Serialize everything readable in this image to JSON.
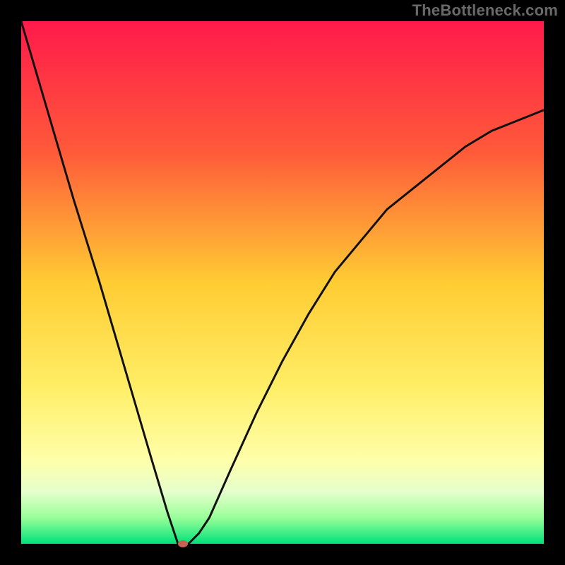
{
  "watermark": "TheBottleneck.com",
  "chart_data": {
    "type": "line",
    "title": "",
    "xlabel": "",
    "ylabel": "",
    "xlim": [
      0,
      1
    ],
    "ylim": [
      0,
      1
    ],
    "series": [
      {
        "name": "curve",
        "x": [
          0.0,
          0.05,
          0.1,
          0.15,
          0.2,
          0.25,
          0.28,
          0.3,
          0.32,
          0.34,
          0.36,
          0.4,
          0.45,
          0.5,
          0.55,
          0.6,
          0.65,
          0.7,
          0.75,
          0.8,
          0.85,
          0.9,
          0.95,
          1.0
        ],
        "y": [
          1.0,
          0.83,
          0.66,
          0.5,
          0.33,
          0.16,
          0.06,
          0.0,
          0.0,
          0.02,
          0.05,
          0.14,
          0.25,
          0.35,
          0.44,
          0.52,
          0.58,
          0.64,
          0.68,
          0.72,
          0.76,
          0.79,
          0.81,
          0.83
        ]
      }
    ],
    "marker": {
      "x": 0.31,
      "y": 0.0
    },
    "background_gradient": {
      "stops": [
        {
          "pos": 0.0,
          "color": "#ff1a4a"
        },
        {
          "pos": 0.25,
          "color": "#ff5a3a"
        },
        {
          "pos": 0.5,
          "color": "#ffcc33"
        },
        {
          "pos": 0.7,
          "color": "#ffee66"
        },
        {
          "pos": 0.84,
          "color": "#ffffaa"
        },
        {
          "pos": 0.9,
          "color": "#e6ffcc"
        },
        {
          "pos": 0.95,
          "color": "#99ff99"
        },
        {
          "pos": 1.0,
          "color": "#00e07a"
        }
      ]
    },
    "line_color": "#111111",
    "line_width": 3
  }
}
